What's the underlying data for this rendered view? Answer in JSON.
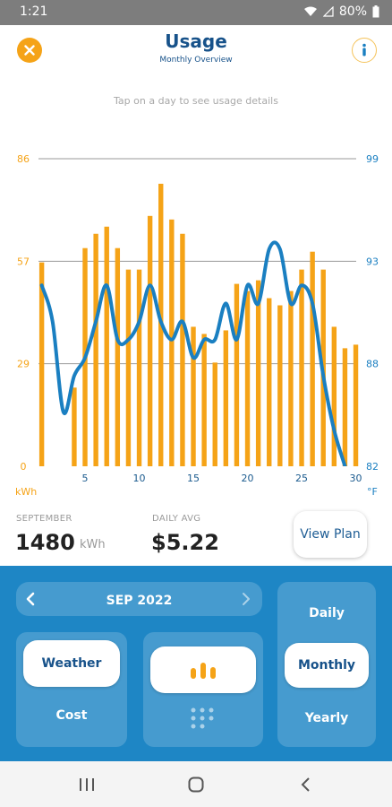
{
  "status_bar": {
    "time": "1:21",
    "battery": "80%"
  },
  "header": {
    "title": "Usage",
    "subtitle": "Monthly Overview"
  },
  "hint": "Tap on a day to see usage details",
  "chart_data": {
    "type": "bar",
    "x_ticks": [
      5,
      10,
      15,
      20,
      25,
      30
    ],
    "days": [
      1,
      2,
      3,
      4,
      5,
      6,
      7,
      8,
      9,
      10,
      11,
      12,
      13,
      14,
      15,
      16,
      17,
      18,
      19,
      20,
      21,
      22,
      23,
      24,
      25,
      26,
      27,
      28,
      29,
      30
    ],
    "kwh": [
      57,
      0,
      0,
      22,
      61,
      65,
      67,
      61,
      55,
      55,
      70,
      79,
      69,
      65,
      39,
      37,
      29,
      38,
      51,
      49,
      52,
      47,
      45,
      49,
      55,
      60,
      55,
      39,
      33,
      34
    ],
    "temperature_f": [
      92,
      90,
      85,
      87,
      88,
      90,
      92,
      89,
      89,
      90,
      92,
      90,
      89,
      90,
      88,
      89,
      89,
      91,
      89,
      92,
      91,
      94,
      94,
      91,
      92,
      91,
      87,
      84,
      82,
      80
    ],
    "left_axis": {
      "label": "kWh",
      "ticks": [
        "0",
        "29",
        "57",
        "86"
      ],
      "range": [
        0,
        86
      ]
    },
    "right_axis": {
      "label": "°F",
      "ticks": [
        "82",
        "88",
        "93",
        "99"
      ],
      "range": [
        82,
        99
      ]
    },
    "bar_color": "#f5a317",
    "line_color": "#1a7fc1",
    "grid": true
  },
  "summary": {
    "month_label": "SEPTEMBER",
    "total_value": "1480",
    "total_unit": "kWh",
    "avg_label": "DAILY AVG",
    "avg_value": "$5.22",
    "view_plan": "View Plan"
  },
  "controls": {
    "month": "SEP 2022",
    "weather": "Weather",
    "cost": "Cost",
    "daily": "Daily",
    "monthly": "Monthly",
    "yearly": "Yearly"
  },
  "colors": {
    "brand_blue": "#17528a",
    "accent_orange": "#f5a317",
    "panel_blue": "#1e86c5"
  }
}
